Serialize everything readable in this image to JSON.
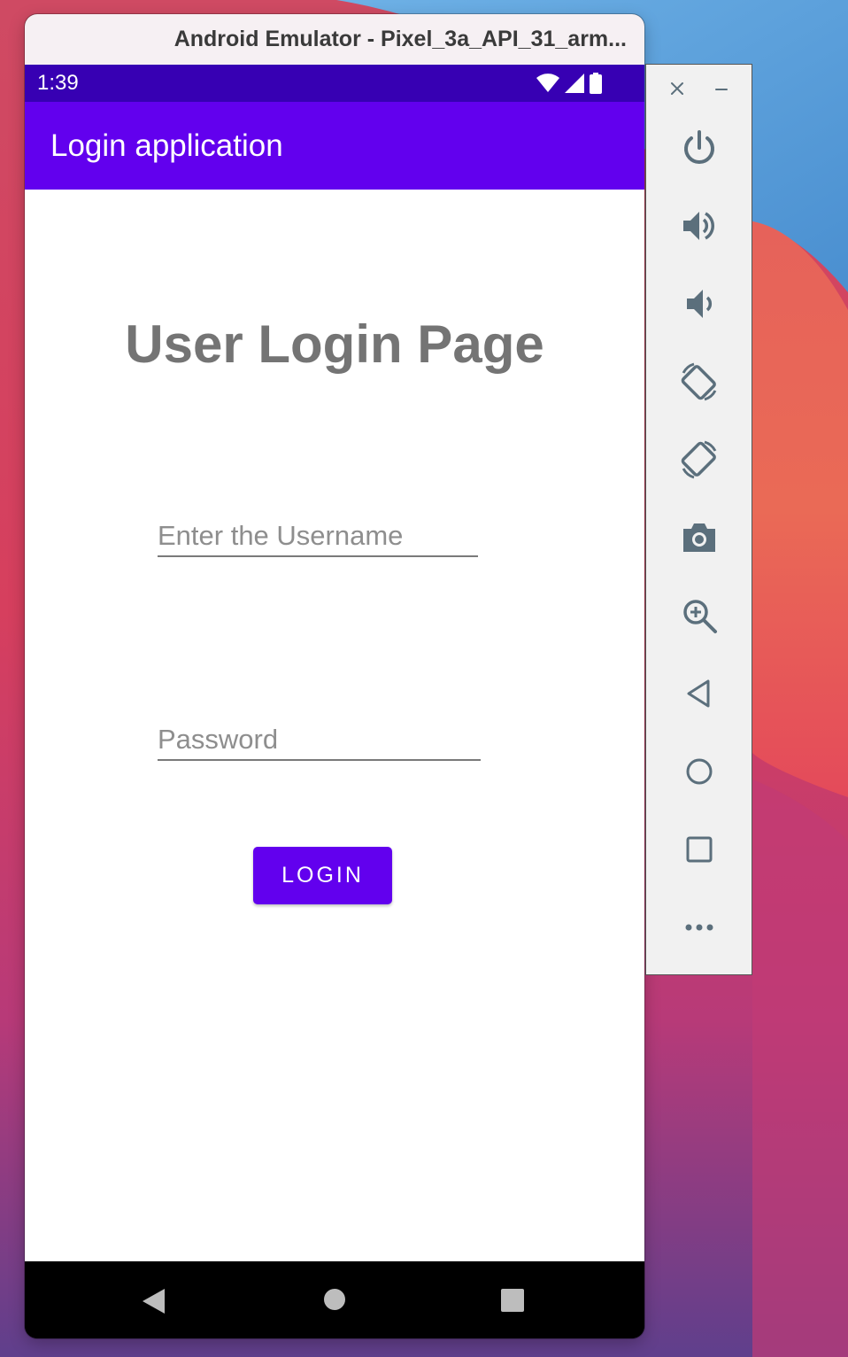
{
  "window": {
    "title": "Android Emulator - Pixel_3a_API_31_arm..."
  },
  "status_bar": {
    "time": "1:39",
    "icons": [
      "wifi-icon",
      "cell-signal-icon",
      "battery-icon"
    ]
  },
  "app_bar": {
    "title": "Login application"
  },
  "main": {
    "page_title": "User Login Page",
    "username_placeholder": "Enter the Username",
    "password_placeholder": "Password",
    "login_label": "LOGIN"
  },
  "nav_bar": {
    "buttons": [
      "back-icon",
      "home-icon",
      "recents-icon"
    ]
  },
  "toolbar": {
    "buttons": [
      "close-icon",
      "minimize-icon",
      "power-icon",
      "volume-up-icon",
      "volume-down-icon",
      "rotate-left-icon",
      "rotate-right-icon",
      "camera-icon",
      "zoom-icon",
      "back-icon",
      "home-icon",
      "overview-icon",
      "more-icon"
    ]
  },
  "colors": {
    "primary": "#6200ee",
    "primary_dark": "#3700b3",
    "toolbar_icon": "#5b6f7c"
  }
}
